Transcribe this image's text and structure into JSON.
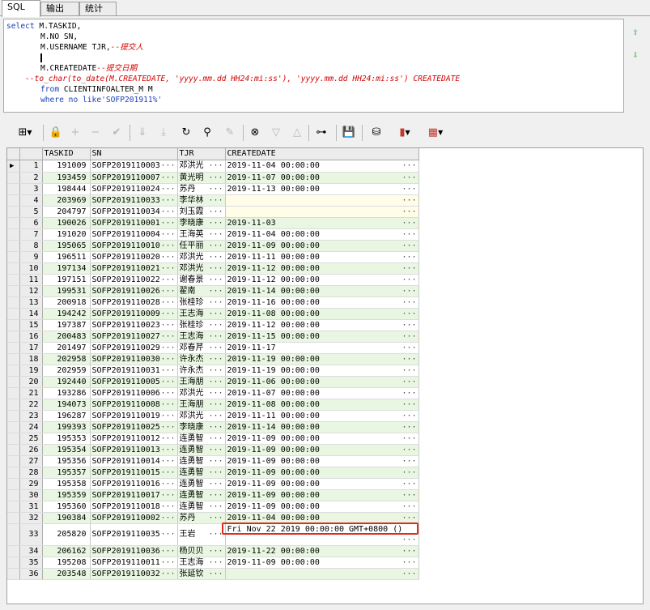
{
  "tabs": [
    "SQL",
    "输出",
    "统计"
  ],
  "editor": {
    "line1_kw": "select",
    "line1_text": " M.TASKID,",
    "line2": "M.NO SN,",
    "line3": "M.USERNAME TJR,",
    "line3_comment": "--提交人",
    "line5": "M.CREATEDATE",
    "line5_comment": "--提交日期",
    "line6_comment": "--to_char(to_date(M.CREATEDATE, 'yyyy.mm.dd HH24:mi:ss'), 'yyyy.mm.dd HH24:mi:ss') CREATEDATE",
    "line7_kw": "from",
    "line7_text": " CLIENTINFOALTER_M M",
    "line8_kw": "where",
    "line8_text": " no like",
    "line8_str": "'SOFP201911%'"
  },
  "side_buttons": {
    "up": "⇧",
    "down": "⇩"
  },
  "toolbar": {
    "grid_icon": "⊞",
    "lock_icon": "🔒",
    "add_icon": "+",
    "remove_icon": "−",
    "post_icon": "✔",
    "fetch_next_icon": "⇓",
    "fetch_all_icon": "⤓",
    "refresh_icon": "↻",
    "find_icon": "⚲",
    "clear_icon": "✎",
    "query_icon": "⊗",
    "filter_icon": "▽",
    "sort_icon": "△",
    "tree_icon": "⊶",
    "save_icon": "💾",
    "export_icon": "⛁",
    "chart_icon": "▮",
    "table_icon": "▦"
  },
  "grid": {
    "columns": [
      "TASKID",
      "SN",
      "TJR",
      "CREATEDATE"
    ],
    "dots": "···",
    "rows": [
      [
        "1",
        "191009",
        "SOFP2019110003",
        "邓洪光",
        "2019-11-04 00:00:00"
      ],
      [
        "2",
        "193459",
        "SOFP2019110007",
        "黄光明",
        "2019-11-07 00:00:00"
      ],
      [
        "3",
        "198444",
        "SOFP2019110024",
        "苏丹",
        "2019-11-13 00:00:00"
      ],
      [
        "4",
        "203969",
        "SOFP2019110033",
        "李华林",
        ""
      ],
      [
        "5",
        "204797",
        "SOFP2019110034",
        "刘玉霞",
        ""
      ],
      [
        "6",
        "190026",
        "SOFP2019110001",
        "李晓康",
        "2019-11-03"
      ],
      [
        "7",
        "191020",
        "SOFP2019110004",
        "王海英",
        "2019-11-04 00:00:00"
      ],
      [
        "8",
        "195065",
        "SOFP2019110010",
        "任平丽",
        "2019-11-09 00:00:00"
      ],
      [
        "9",
        "196511",
        "SOFP2019110020",
        "邓洪光",
        "2019-11-11 00:00:00"
      ],
      [
        "10",
        "197134",
        "SOFP2019110021",
        "邓洪光",
        "2019-11-12 00:00:00"
      ],
      [
        "11",
        "197151",
        "SOFP2019110022",
        "谢春景",
        "2019-11-12 00:00:00"
      ],
      [
        "12",
        "199531",
        "SOFP2019110026",
        "翟南",
        "2019-11-14 00:00:00"
      ],
      [
        "13",
        "200918",
        "SOFP2019110028",
        "张桂珍",
        "2019-11-16 00:00:00"
      ],
      [
        "14",
        "194242",
        "SOFP2019110009",
        "王志海",
        "2019-11-08 00:00:00"
      ],
      [
        "15",
        "197387",
        "SOFP2019110023",
        "张桂珍",
        "2019-11-12 00:00:00"
      ],
      [
        "16",
        "200483",
        "SOFP2019110027",
        "王志海",
        "2019-11-15 00:00:00"
      ],
      [
        "17",
        "201497",
        "SOFP2019110029",
        "邓春芹",
        "2019-11-17"
      ],
      [
        "18",
        "202958",
        "SOFP2019110030",
        "许永杰",
        "2019-11-19 00:00:00"
      ],
      [
        "19",
        "202959",
        "SOFP2019110031",
        "许永杰",
        "2019-11-19 00:00:00"
      ],
      [
        "20",
        "192440",
        "SOFP2019110005",
        "王海朋",
        "2019-11-06 00:00:00"
      ],
      [
        "21",
        "193286",
        "SOFP2019110006",
        "邓洪光",
        "2019-11-07 00:00:00"
      ],
      [
        "22",
        "194073",
        "SOFP2019110008",
        "王海朋",
        "2019-11-08 00:00:00"
      ],
      [
        "23",
        "196287",
        "SOFP2019110019",
        "邓洪光",
        "2019-11-11 00:00:00"
      ],
      [
        "24",
        "199393",
        "SOFP2019110025",
        "李晓康",
        "2019-11-14 00:00:00"
      ],
      [
        "25",
        "195353",
        "SOFP2019110012",
        "连勇智",
        "2019-11-09 00:00:00"
      ],
      [
        "26",
        "195354",
        "SOFP2019110013",
        "连勇智",
        "2019-11-09 00:00:00"
      ],
      [
        "27",
        "195356",
        "SOFP2019110014",
        "连勇智",
        "2019-11-09 00:00:00"
      ],
      [
        "28",
        "195357",
        "SOFP2019110015",
        "连勇智",
        "2019-11-09 00:00:00"
      ],
      [
        "29",
        "195358",
        "SOFP2019110016",
        "连勇智",
        "2019-11-09 00:00:00"
      ],
      [
        "30",
        "195359",
        "SOFP2019110017",
        "连勇智",
        "2019-11-09 00:00:00"
      ],
      [
        "31",
        "195360",
        "SOFP2019110018",
        "连勇智",
        "2019-11-09 00:00:00"
      ],
      [
        "32",
        "190384",
        "SOFP2019110002",
        "苏丹",
        "2019-11-04 00:00:00"
      ],
      [
        "33",
        "205820",
        "SOFP2019110035",
        "王岩",
        "Fri Nov 22 2019 00:00:00 GMT+0800 ()"
      ],
      [
        "34",
        "206162",
        "SOFP2019110036",
        "杨贝贝",
        "2019-11-22 00:00:00"
      ],
      [
        "35",
        "195208",
        "SOFP2019110011",
        "王志海",
        "2019-11-09 00:00:00"
      ],
      [
        "36",
        "203548",
        "SOFP2019110032",
        "张延钦",
        ""
      ]
    ]
  },
  "colors": {
    "highlight": "#e02a1c",
    "alt_row": "#e9f7e2",
    "keyword": "#1c3fb5",
    "comment": "#d40000"
  }
}
